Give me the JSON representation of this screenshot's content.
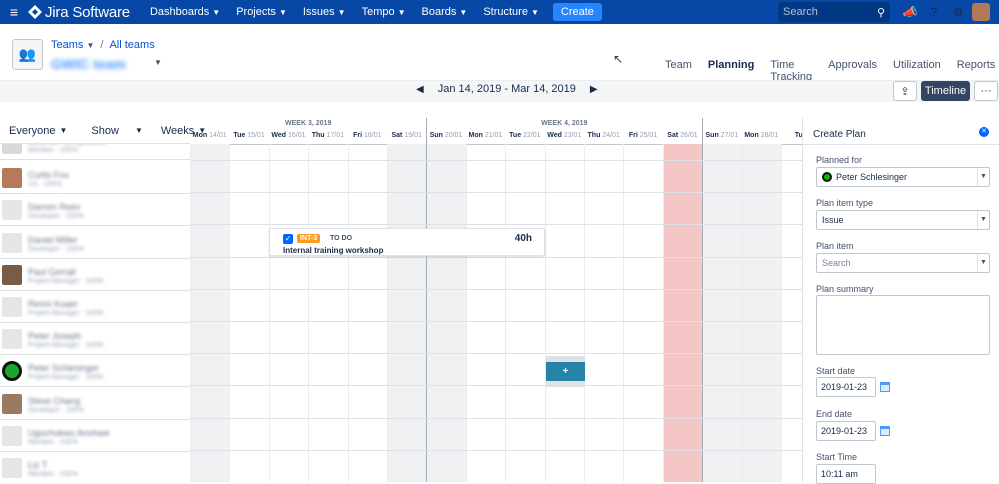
{
  "nav": {
    "brand": "Jira Software",
    "items": [
      "Dashboards",
      "Projects",
      "Issues",
      "Tempo",
      "Boards",
      "Structure"
    ],
    "create": "Create",
    "search_placeholder": "Search"
  },
  "header": {
    "breadcrumb_teams": "Teams",
    "breadcrumb_all": "All teams",
    "team_name": "GWIC team",
    "tabs": [
      "Team",
      "Planning",
      "Time Tracking",
      "Approvals",
      "Utilization",
      "Reports"
    ],
    "active_tab": "Planning"
  },
  "toolbar": {
    "date_range": "Jan 14, 2019 - Mar 14, 2019",
    "timeline": "Timeline",
    "more": "···"
  },
  "controls": {
    "everyone": "Everyone",
    "show": "Show",
    "weeks": "Weeks"
  },
  "calendar": {
    "week_labels": [
      "WEEK 3, 2019",
      "WEEK 4, 2019"
    ],
    "days": [
      {
        "n": "Mon",
        "d": "14/01"
      },
      {
        "n": "Tue",
        "d": "15/01"
      },
      {
        "n": "Wed",
        "d": "16/01"
      },
      {
        "n": "Thu",
        "d": "17/01"
      },
      {
        "n": "Fri",
        "d": "18/01"
      },
      {
        "n": "Sat",
        "d": "19/01"
      },
      {
        "n": "Sun",
        "d": "20/01"
      },
      {
        "n": "Mon",
        "d": "21/01"
      },
      {
        "n": "Tue",
        "d": "22/01"
      },
      {
        "n": "Wed",
        "d": "23/01"
      },
      {
        "n": "Thu",
        "d": "24/01"
      },
      {
        "n": "Fri",
        "d": "25/01"
      },
      {
        "n": "Sat",
        "d": "26/01"
      },
      {
        "n": "Sun",
        "d": "27/01"
      },
      {
        "n": "Mon",
        "d": "28/01"
      },
      {
        "n": "Tue",
        "d": ""
      }
    ]
  },
  "people": [
    {
      "name": "Guenter Greybeard",
      "role": "Member - 100%"
    },
    {
      "name": "Curtis Fox",
      "role": "UX - 100%"
    },
    {
      "name": "Damon Reev",
      "role": "Developer - 100%"
    },
    {
      "name": "Daniel Miller",
      "role": "Developer - 100%"
    },
    {
      "name": "Paul Gerrall",
      "role": "Project Manager - 100%"
    },
    {
      "name": "Renni Kuaer",
      "role": "Project Manager - 100%"
    },
    {
      "name": "Peter Joseph",
      "role": "Project Manager - 100%"
    },
    {
      "name": "Peter Schlesinger",
      "role": "Project Manager - 100%"
    },
    {
      "name": "Steve Chang",
      "role": "Developer - 100%"
    },
    {
      "name": "Ugochukwu Anohwe",
      "role": "Member - 100%"
    },
    {
      "name": "Liz T",
      "role": "Member - 100%"
    }
  ],
  "task": {
    "key": "INT-3",
    "status": "TO DO",
    "hours": "40h",
    "summary": "Internal training workshop"
  },
  "add_button": "+",
  "panel": {
    "title": "Create Plan",
    "planned_for_label": "Planned for",
    "planned_for_value": "Peter Schlesinger",
    "plan_item_type_label": "Plan item type",
    "plan_item_type_value": "Issue",
    "plan_item_label": "Plan item",
    "plan_item_placeholder": "Search",
    "plan_summary_label": "Plan summary",
    "start_date_label": "Start date",
    "start_date_value": "2019-01-23",
    "end_date_label": "End date",
    "end_date_value": "2019-01-23",
    "start_time_label": "Start Time",
    "start_time_value": "10:11 am"
  }
}
